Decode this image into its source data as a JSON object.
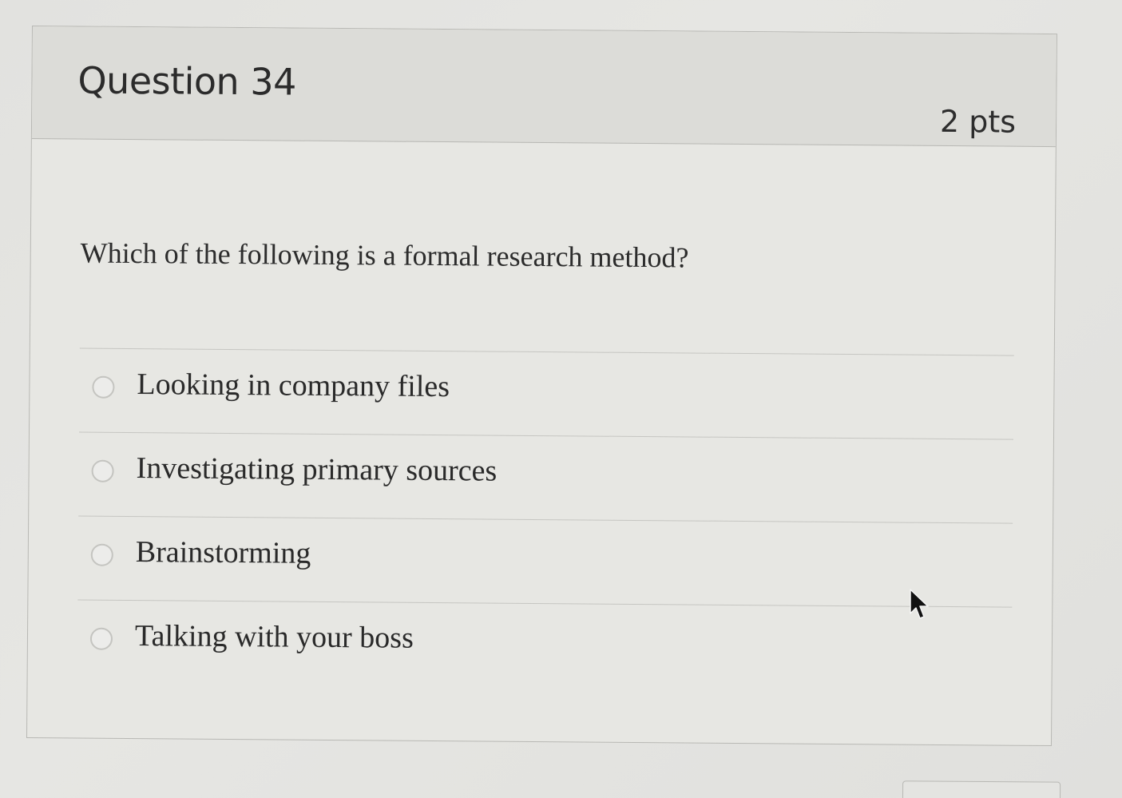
{
  "question": {
    "title": "Question 34",
    "points": "2 pts",
    "text": "Which of the following is a formal research method?",
    "answers": [
      {
        "label": "Looking in company files",
        "selected": false
      },
      {
        "label": "Investigating primary sources",
        "selected": false
      },
      {
        "label": "Brainstorming",
        "selected": false
      },
      {
        "label": "Talking with your boss",
        "selected": false
      }
    ]
  },
  "cursor": {
    "icon": "mouse-pointer-icon"
  }
}
